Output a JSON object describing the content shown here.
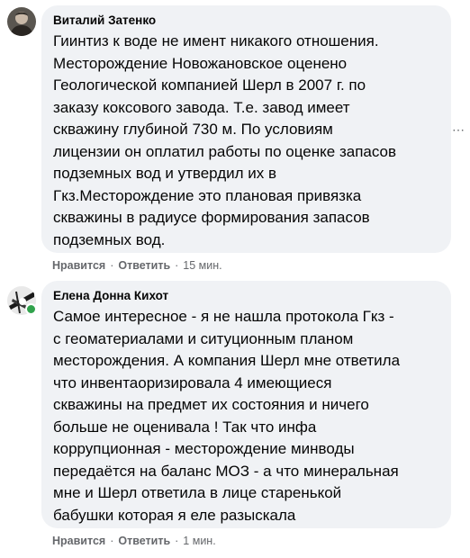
{
  "comments": [
    {
      "author": "Виталий Затенко",
      "text": "Гиинтиз к воде не имент никакого отношения.\nМесторождение Новожановское оценено\nГеологической компанией Шерл в 2007 г. по\nзаказу коксового завода. Т.е. завод имеет\nскважину глубиной 730 м. По условиям\nлицензии он оплатил работы по оценке запасов\nподземных вод и утвердил их в\nГкз.Месторождение это плановая привязка\nскважины в радиусе формирования запасов\nподземных вод.",
      "like_label": "Нравится",
      "reply_label": "Ответить",
      "separator": "·",
      "time": "15 мин.",
      "avatar_icon": "profile-photo-icon"
    },
    {
      "author": "Елена Донна Кихот",
      "text": "Самое интересное - я не нашла протокола Гкз -\nс геоматериалами и ситуционным планом\nместорождения. А компания Шерл мне ответила\nчто инвентаоризировала 4 имеющиеся\nскважины на предмет их состояния и ничего\nбольше не оценивала ! Так что инфа\nкоррупционная - месторождение минводы\nпередаётся на баланс МОЗ - а что минеральная\nмне и Шерл ответила в лице старенькой\nбабушки которая я еле разыскала",
      "like_label": "Нравится",
      "reply_label": "Ответить",
      "separator": "·",
      "time": "1 мин.",
      "avatar_icon": "profile-photo-icon",
      "online": true
    }
  ],
  "more_icon": "more-options-icon",
  "more_glyph": "⋯",
  "colors": {
    "bubble": "#f0f2f5",
    "meta": "#65676b",
    "online": "#31a24c",
    "text": "#050505"
  }
}
